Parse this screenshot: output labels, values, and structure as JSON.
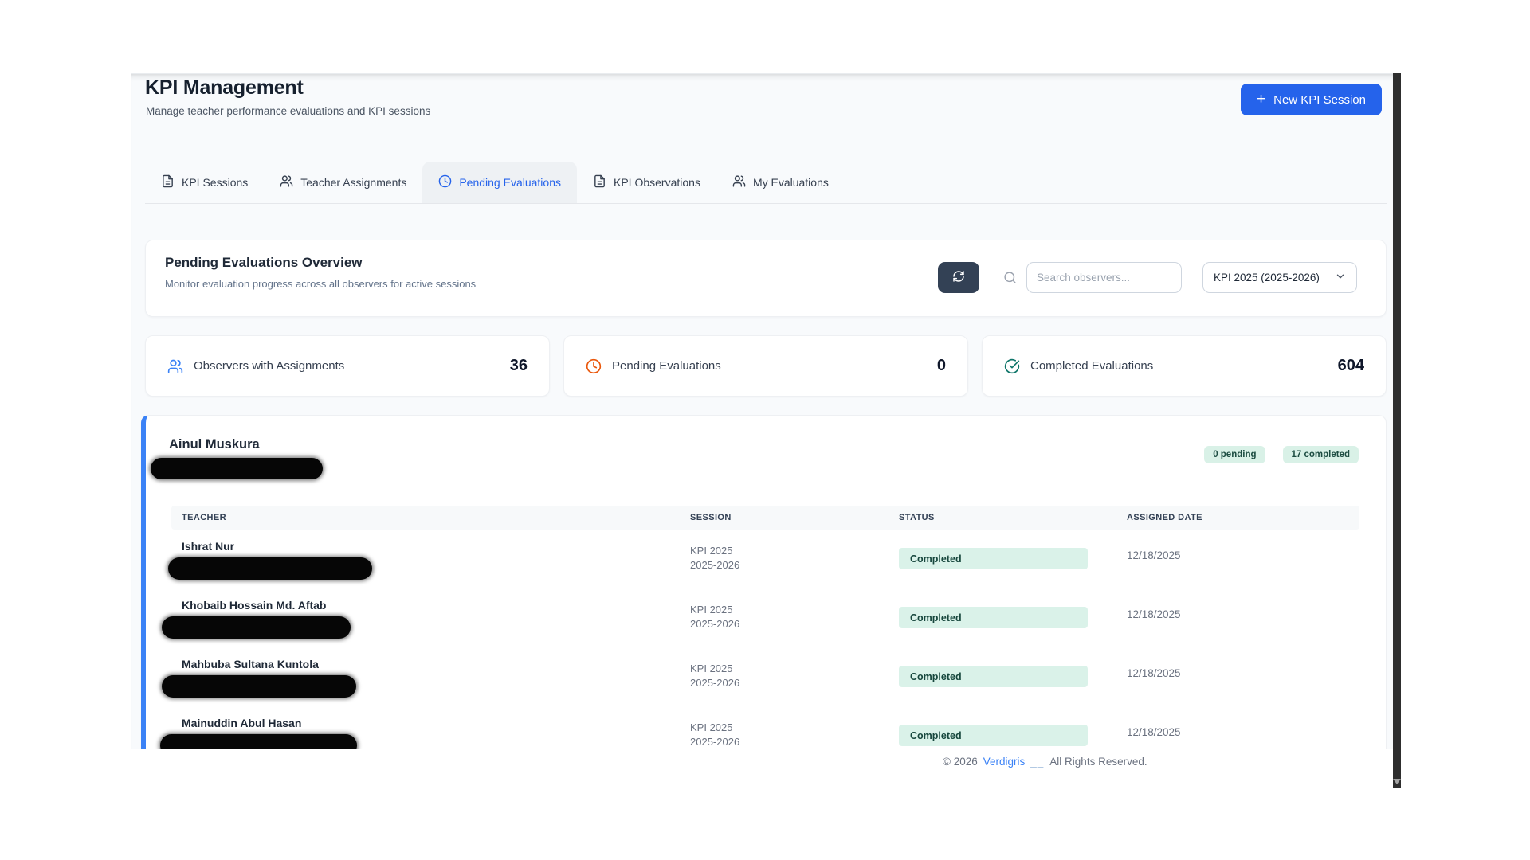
{
  "header": {
    "title": "KPI Management",
    "subtitle": "Manage teacher performance evaluations and KPI sessions",
    "new_session_button": "New KPI Session",
    "plus": "+"
  },
  "tabs": [
    {
      "label": "KPI Sessions",
      "icon": "file-text-icon",
      "active": false
    },
    {
      "label": "Teacher Assignments",
      "icon": "users-icon",
      "active": false
    },
    {
      "label": "Pending Evaluations",
      "icon": "clock-icon",
      "active": true
    },
    {
      "label": "KPI Observations",
      "icon": "file-text-icon",
      "active": false
    },
    {
      "label": "My Evaluations",
      "icon": "users-icon",
      "active": false
    }
  ],
  "overview": {
    "title": "Pending Evaluations Overview",
    "subtitle": "Monitor evaluation progress across all observers for active sessions",
    "search_placeholder": "Search observers...",
    "session_filter_value": "KPI 2025 (2025-2026)"
  },
  "stats": [
    {
      "label": "Observers with Assignments",
      "value": "36",
      "icon": "users-icon",
      "color": "#3b82f6"
    },
    {
      "label": "Pending Evaluations",
      "value": "0",
      "icon": "clock-icon",
      "color": "#ea580c"
    },
    {
      "label": "Completed Evaluations",
      "value": "604",
      "icon": "check-circle-icon",
      "color": "#0e7569"
    }
  ],
  "observer_card": {
    "name": "Ainul Muskura",
    "email_redacted": true,
    "badges": {
      "pending": "0 pending",
      "completed": "17 completed"
    },
    "table": {
      "columns": [
        "TEACHER",
        "SESSION",
        "STATUS",
        "ASSIGNED DATE"
      ],
      "rows": [
        {
          "teacher": "Ishrat Nur",
          "email_redacted": true,
          "session_line1": "KPI 2025",
          "session_line2": "2025-2026",
          "status": "Completed",
          "assigned_date": "12/18/2025"
        },
        {
          "teacher": "Khobaib Hossain Md. Aftab",
          "email_redacted": true,
          "session_line1": "KPI 2025",
          "session_line2": "2025-2026",
          "status": "Completed",
          "assigned_date": "12/18/2025"
        },
        {
          "teacher": "Mahbuba Sultana Kuntola",
          "email_redacted": true,
          "session_line1": "KPI 2025",
          "session_line2": "2025-2026",
          "status": "Completed",
          "assigned_date": "12/18/2025"
        },
        {
          "teacher": "Mainuddin Abul Hasan",
          "email_redacted": true,
          "session_line1": "KPI 2025",
          "session_line2": "2025-2026",
          "status": "Completed",
          "assigned_date": "12/18/2025"
        }
      ]
    }
  },
  "footer": {
    "copyright": "© 2026",
    "brand": "Verdigris",
    "separator": "__",
    "rights": "All Rights Reserved."
  },
  "colors": {
    "primary_button": "#2563eb",
    "active_tab_text": "#2563eb",
    "refresh_button_bg": "#334155",
    "observer_accent_border": "#3b82f6",
    "badge_bg": "#d9f1e7",
    "badge_text": "#1d4d42",
    "status_pill_bg": "#daf2e9",
    "status_pill_text": "#17473d",
    "stat_icon_blue": "#3b82f6",
    "stat_icon_orange": "#ea580c",
    "stat_icon_teal": "#0e7569",
    "scrollbar": "#2e2e2e",
    "app_background": "#f8fafc"
  }
}
